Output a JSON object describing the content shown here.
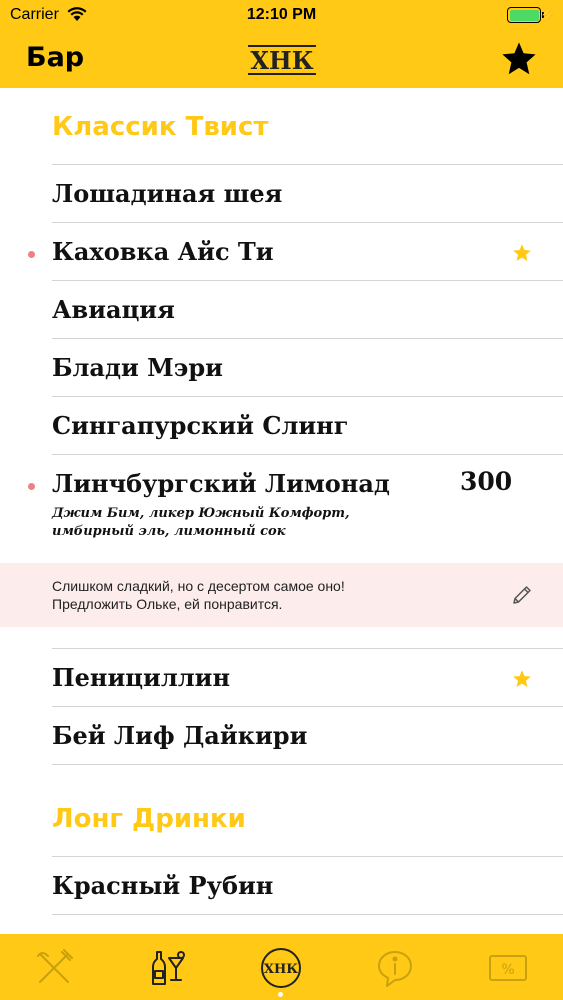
{
  "status_bar": {
    "carrier": "Carrier",
    "time": "12:10 PM"
  },
  "nav": {
    "title": "Бар",
    "logo": "ХНК"
  },
  "sections": [
    {
      "title": "Классик Твист"
    },
    {
      "title": "Лонг Дринки"
    }
  ],
  "items": [
    {
      "name": "Лошадиная шея"
    },
    {
      "name": "Каховка Айс Ти"
    },
    {
      "name": "Авиация"
    },
    {
      "name": "Бл­ади Мэри"
    },
    {
      "name": "Сингапурский Слинг"
    },
    {
      "name": "Линчбургский Лимонад",
      "price": "300",
      "desc_line1": "Джим Бим, ликер Южный Комфорт,",
      "desc_line2": "имбирный эль, лимонный сок"
    },
    {
      "name": "Пенициллин"
    },
    {
      "name": "Бей Лиф Дайкири"
    },
    {
      "name": "Красный Рубин"
    }
  ],
  "note": {
    "line1": "Слишком сладкий, но с десертом самое оно!",
    "line2": "Предложить Ольке, ей понравится."
  },
  "tabs": [
    {
      "icon": "fork-knife-icon"
    },
    {
      "icon": "bar-bottles-icon"
    },
    {
      "icon": "logo-tab-icon"
    },
    {
      "icon": "info-bubble-icon"
    },
    {
      "icon": "discount-icon"
    }
  ],
  "colors": {
    "accent": "#FFC915",
    "dot": "#F08080",
    "note_bg": "#FDECEC"
  }
}
